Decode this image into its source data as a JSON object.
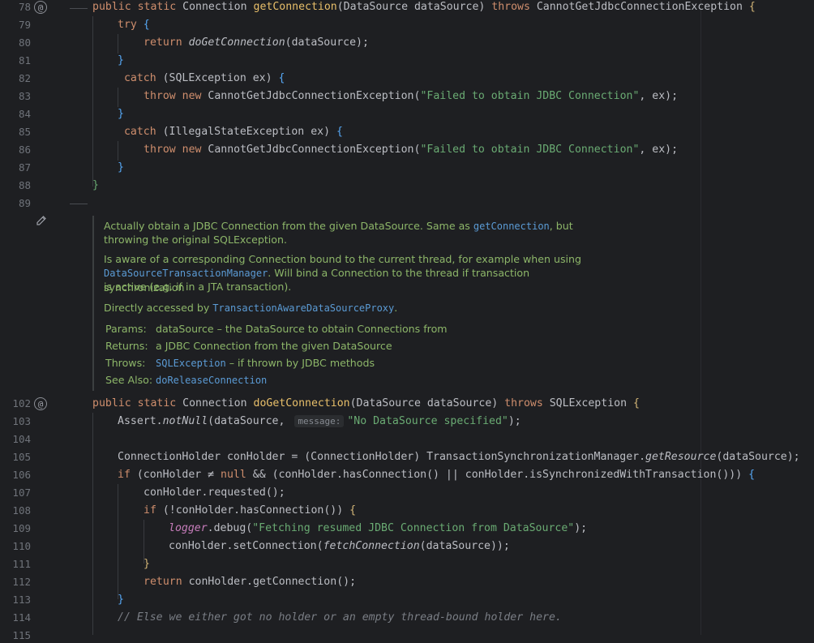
{
  "editor": {
    "line_numbers_top": [
      "78",
      "79",
      "80",
      "81",
      "82",
      "83",
      "84",
      "85",
      "86",
      "87",
      "88",
      "89"
    ],
    "line_numbers_bottom": [
      "102",
      "103",
      "104",
      "105",
      "106",
      "107",
      "108",
      "109",
      "110",
      "111",
      "112",
      "113",
      "114",
      "115"
    ],
    "gutter_icons": [
      "at-icon",
      "edit-doc-icon",
      "at-icon"
    ]
  },
  "code": {
    "l78": {
      "mod": "public static ",
      "type": "Connection ",
      "name": "getConnection",
      "args": "(DataSource dataSource) ",
      "throws": "throws ",
      "exc": "CannotGetJdbcConnectionException ",
      "open": "{"
    },
    "l79": {
      "kw": "try ",
      "open": "{"
    },
    "l80": {
      "kw": "return ",
      "call": "doGetConnection",
      "args": "(dataSource);"
    },
    "l81": {
      "close": "}"
    },
    "l82": {
      "kw": " catch ",
      "args": "(SQLException ex) ",
      "open": "{"
    },
    "l83": {
      "kw": "throw new ",
      "cls": "CannotGetJdbcConnectionException",
      "p1": "(",
      "str": "\"Failed to obtain JDBC Connection\"",
      "p2": ", ex);"
    },
    "l84": {
      "close": "}"
    },
    "l85": {
      "kw": " catch ",
      "args": "(IllegalStateException ex) ",
      "open": "{"
    },
    "l86": {
      "kw": "throw new ",
      "cls": "CannotGetJdbcConnectionException",
      "p1": "(",
      "str": "\"Failed to obtain JDBC Connection\"",
      "p2": ", ex);"
    },
    "l87": {
      "close": "}"
    },
    "l88": {
      "close": "}"
    },
    "l102": {
      "mod": "public static ",
      "type": "Connection ",
      "name": "doGetConnection",
      "args": "(DataSource dataSource) ",
      "throws": "throws ",
      "exc": "SQLException ",
      "open": "{"
    },
    "l103": {
      "pre": "Assert.",
      "call": "notNull",
      "p1": "(dataSource, ",
      "hint": "message:",
      "str": "\"No DataSource specified\"",
      "p2": ");"
    },
    "l105": {
      "a": "ConnectionHolder conHolder = (ConnectionHolder) TransactionSynchronizationManager.",
      "call": "getResource",
      "b": "(dataSource);"
    },
    "l106": {
      "kw": "if ",
      "a": "(conHolder ≠ ",
      "kw2": "null ",
      "b": "&& (conHolder.hasConnection() || conHolder.isSynchronizedWithTransaction())) ",
      "open": "{"
    },
    "l107": {
      "a": "conHolder.requested();"
    },
    "l108": {
      "kw": "if ",
      "a": "(!conHolder.hasConnection()) ",
      "open": "{"
    },
    "l109": {
      "field": "logger",
      "a": ".debug(",
      "str": "\"Fetching resumed JDBC Connection from DataSource\"",
      "b": ");"
    },
    "l110": {
      "a": "conHolder.setConnection(",
      "call": "fetchConnection",
      "b": "(dataSource));"
    },
    "l111": {
      "close": "}"
    },
    "l112": {
      "kw": "return ",
      "a": "conHolder.getConnection();"
    },
    "l113": {
      "close": "}"
    },
    "l114": {
      "com": "// Else we either got no holder or an empty thread-bound holder here."
    }
  },
  "doc": {
    "p1a": "Actually obtain a JDBC Connection from the given DataSource. Same as ",
    "p1link": "getConnection",
    "p1b": ", but",
    "p1c": "throwing the original SQLException.",
    "p2a": "Is aware of a corresponding Connection bound to the current thread, for example when using",
    "p2link": "DataSourceTransactionManager",
    "p2b": ". Will bind a Connection to the thread if transaction synchronization",
    "p2c": "is active (e.g. if in a JTA transaction).",
    "p3a": "Directly accessed by ",
    "p3link": "TransactionAwareDataSourceProxy",
    "p3b": ".",
    "params_tag": "Params:",
    "params_val": "dataSource – the DataSource to obtain Connections from",
    "returns_tag": "Returns:",
    "returns_val": "a JDBC Connection from the given DataSource",
    "throws_tag": "Throws:",
    "throws_link": "SQLException",
    "throws_val": " – if thrown by JDBC methods",
    "seealso_tag": "See Also:",
    "seealso_link": "doReleaseConnection"
  }
}
